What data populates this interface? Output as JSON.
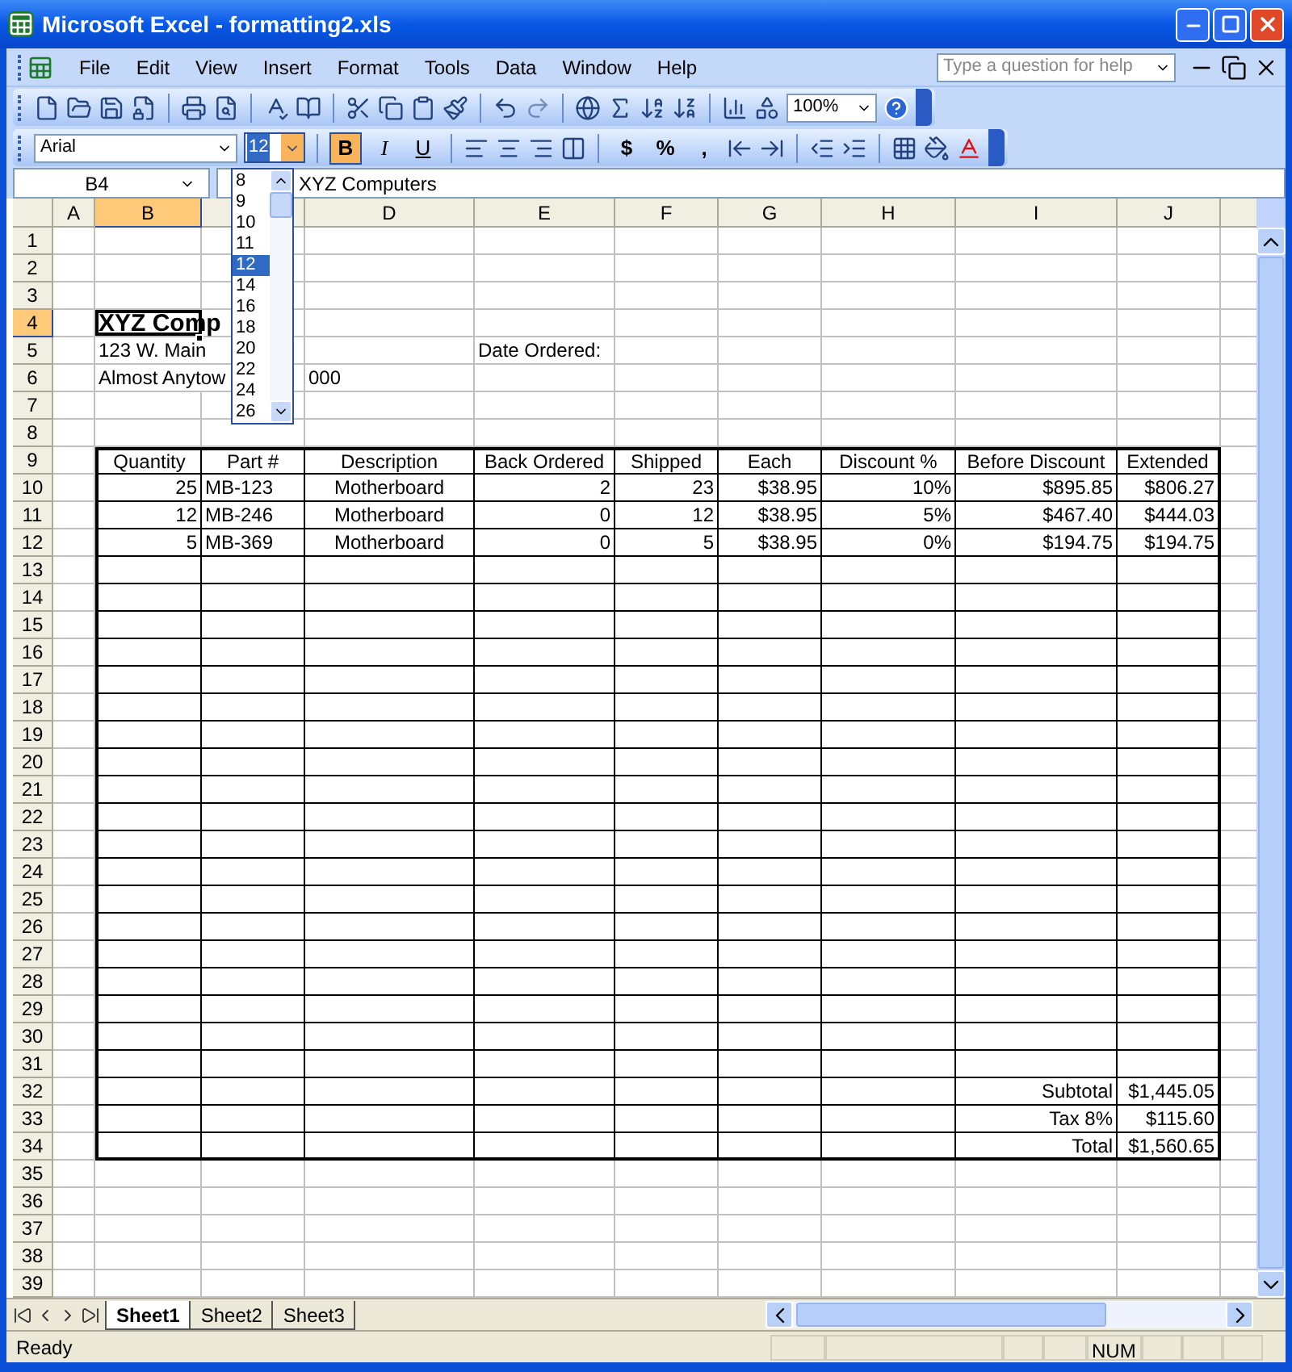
{
  "window": {
    "title": "Microsoft Excel - formatting2.xls"
  },
  "menu": [
    "File",
    "Edit",
    "View",
    "Insert",
    "Format",
    "Tools",
    "Data",
    "Window",
    "Help"
  ],
  "help_box": {
    "placeholder": "Type a question for help"
  },
  "standard_toolbar": {
    "zoom": "100%"
  },
  "formatting_toolbar": {
    "font": "Arial",
    "font_size": "12",
    "style_buttons": [
      {
        "label": "B",
        "selected": true
      },
      {
        "label": "I",
        "selected": false
      },
      {
        "label": "U",
        "selected": false
      }
    ],
    "number_buttons": [
      "$",
      "%",
      ","
    ]
  },
  "font_size_list": [
    {
      "label": "8",
      "selected": false
    },
    {
      "label": "9",
      "selected": false
    },
    {
      "label": "10",
      "selected": false
    },
    {
      "label": "11",
      "selected": false
    },
    {
      "label": "12",
      "selected": true
    },
    {
      "label": "14",
      "selected": false
    },
    {
      "label": "16",
      "selected": false
    },
    {
      "label": "18",
      "selected": false
    },
    {
      "label": "20",
      "selected": false
    },
    {
      "label": "22",
      "selected": false
    },
    {
      "label": "24",
      "selected": false
    },
    {
      "label": "26",
      "selected": false
    }
  ],
  "formula_bar": {
    "name_box": "B4",
    "content": "XYZ Computers"
  },
  "columns": [
    {
      "label": "A",
      "selected": false
    },
    {
      "label": "B",
      "selected": true
    },
    {
      "selected": false
    },
    {
      "label": "D",
      "selected": false
    },
    {
      "label": "E",
      "selected": false
    },
    {
      "label": "F",
      "selected": false
    },
    {
      "label": "G",
      "selected": false
    },
    {
      "label": "H",
      "selected": false
    },
    {
      "label": "I",
      "selected": false
    },
    {
      "label": "J",
      "selected": false
    }
  ],
  "rows": [
    {
      "label": "1",
      "selected": false,
      "kind": "blank"
    },
    {
      "label": "2",
      "selected": false,
      "kind": "blank"
    },
    {
      "label": "3",
      "selected": false,
      "kind": "blank"
    },
    {
      "label": "4",
      "selected": true,
      "kind": "title",
      "cells": {
        "b": {
          "text": "XYZ Comp",
          "active": true
        }
      }
    },
    {
      "label": "5",
      "selected": false,
      "kind": "address",
      "cells": {
        "b": "123 W. Main",
        "e": "Date Ordered:"
      }
    },
    {
      "label": "6",
      "selected": false,
      "kind": "address",
      "cells": {
        "b": "Almost Anytow",
        "d": "000"
      }
    },
    {
      "label": "7",
      "selected": false,
      "kind": "blank"
    },
    {
      "label": "8",
      "selected": false,
      "kind": "blank"
    },
    {
      "label": "9",
      "selected": false,
      "kind": "header",
      "cells": {
        "b": "Quantity",
        "c": "Part #",
        "d": "Description",
        "e": "Back Ordered",
        "f": "Shipped",
        "g": "Each",
        "h": "Discount %",
        "i": "Before Discount",
        "j": "Extended"
      }
    },
    {
      "label": "10",
      "selected": false,
      "kind": "item",
      "cells": {
        "b": "25",
        "c": "MB-123",
        "d": "Motherboard",
        "e": "2",
        "f": "23",
        "g": "$38.95",
        "h": "10%",
        "i": "$895.85",
        "j": "$806.27"
      }
    },
    {
      "label": "11",
      "selected": false,
      "kind": "item",
      "cells": {
        "b": "12",
        "c": "MB-246",
        "d": "Motherboard",
        "e": "0",
        "f": "12",
        "g": "$38.95",
        "h": "5%",
        "i": "$467.40",
        "j": "$444.03"
      }
    },
    {
      "label": "12",
      "selected": false,
      "kind": "item",
      "cells": {
        "b": "5",
        "c": "MB-369",
        "d": "Motherboard",
        "e": "0",
        "f": "5",
        "g": "$38.95",
        "h": "0%",
        "i": "$194.75",
        "j": "$194.75"
      }
    },
    {
      "label": "13",
      "selected": false,
      "kind": "table_blank"
    },
    {
      "label": "14",
      "selected": false,
      "kind": "table_blank"
    },
    {
      "label": "15",
      "selected": false,
      "kind": "table_blank"
    },
    {
      "label": "16",
      "selected": false,
      "kind": "table_blank"
    },
    {
      "label": "17",
      "selected": false,
      "kind": "table_blank"
    },
    {
      "label": "18",
      "selected": false,
      "kind": "table_blank"
    },
    {
      "label": "19",
      "selected": false,
      "kind": "table_blank"
    },
    {
      "label": "20",
      "selected": false,
      "kind": "table_blank"
    },
    {
      "label": "21",
      "selected": false,
      "kind": "table_blank"
    },
    {
      "label": "22",
      "selected": false,
      "kind": "table_blank"
    },
    {
      "label": "23",
      "selected": false,
      "kind": "table_blank"
    },
    {
      "label": "24",
      "selected": false,
      "kind": "table_blank"
    },
    {
      "label": "25",
      "selected": false,
      "kind": "table_blank"
    },
    {
      "label": "26",
      "selected": false,
      "kind": "table_blank"
    },
    {
      "label": "27",
      "selected": false,
      "kind": "table_blank"
    },
    {
      "label": "28",
      "selected": false,
      "kind": "table_blank"
    },
    {
      "label": "29",
      "selected": false,
      "kind": "table_blank"
    },
    {
      "label": "30",
      "selected": false,
      "kind": "table_blank"
    },
    {
      "label": "31",
      "selected": false,
      "kind": "table_blank"
    },
    {
      "label": "32",
      "selected": false,
      "kind": "total",
      "cells": {
        "i": "Subtotal",
        "j": "$1,445.05"
      }
    },
    {
      "label": "33",
      "selected": false,
      "kind": "total",
      "cells": {
        "i": "Tax 8%",
        "j": "$115.60"
      }
    },
    {
      "label": "34",
      "selected": false,
      "kind": "total",
      "cells": {
        "i": "Total",
        "j": "$1,560.65"
      }
    },
    {
      "label": "35",
      "selected": false,
      "kind": "blank"
    },
    {
      "label": "36",
      "selected": false,
      "kind": "blank"
    },
    {
      "label": "37",
      "selected": false,
      "kind": "blank"
    },
    {
      "label": "38",
      "selected": false,
      "kind": "blank"
    },
    {
      "label": "39",
      "selected": false,
      "kind": "blank"
    }
  ],
  "sheet_tabs": [
    {
      "label": "Sheet1",
      "selected": true
    },
    {
      "label": "Sheet2",
      "selected": false
    },
    {
      "label": "Sheet3",
      "selected": false
    }
  ],
  "status_bar": {
    "status": "Ready",
    "indicator": "NUM"
  }
}
